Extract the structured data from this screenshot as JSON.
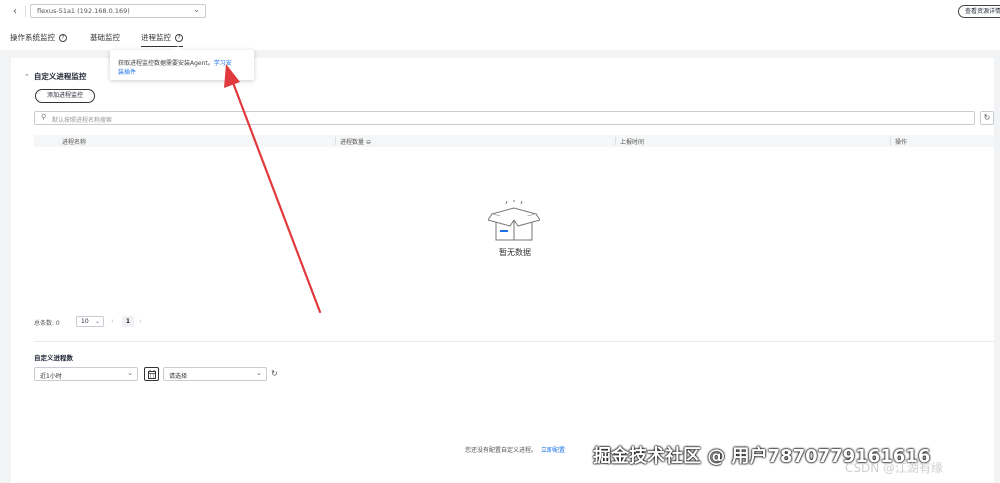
{
  "header": {
    "back_icon": "chevron-left-icon",
    "instance_value": "flexus-51a1 (192.168.0.169)",
    "top_right_button": "查看资源详情"
  },
  "tabs": [
    {
      "label": "操作系统监控",
      "active": false,
      "help_icon": true
    },
    {
      "label": "基础监控",
      "active": false,
      "help_icon": false
    },
    {
      "label": "进程监控",
      "active": true,
      "help_icon": true
    }
  ],
  "tooltip": {
    "text": "获取进程监控数据需要安装Agent。",
    "link_a": "学习安",
    "link_b": "装插件"
  },
  "custom_process": {
    "section_title": "自定义进程监控",
    "create_button": "添加进程监控",
    "search_placeholder": "默认按照进程名称搜索",
    "columns": [
      "进程名称",
      "进程数量",
      "上报时间",
      "操作"
    ],
    "empty_text": "暂无数据",
    "total_label": "总条数: 0",
    "page_size": "10",
    "current_page": "1"
  },
  "trend": {
    "title": "自定义进程数",
    "time_range": "近1小时",
    "process_placeholder": "请选择",
    "no_config_text": "您还没有配置自定义进程。",
    "config_link": "立即配置"
  },
  "watermark": "掘金技术社区 @ 用户7870779161616",
  "csdn_watermark": "CSDN @江湖有缘",
  "colors": {
    "link": "#1b72e8",
    "arrow": "#e03a3e"
  }
}
